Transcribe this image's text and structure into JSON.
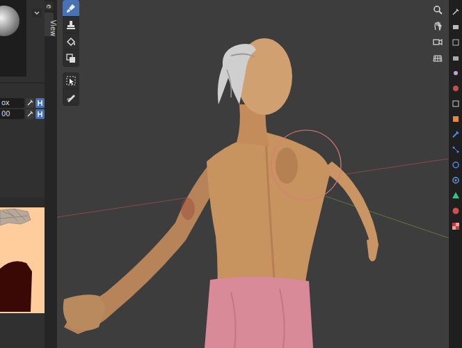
{
  "panel": {
    "rows": [
      {
        "label": "ox",
        "toggled": true
      },
      {
        "label": "00",
        "toggled": true
      }
    ]
  },
  "side_tabs": [
    {
      "label": "e",
      "selected": false
    },
    {
      "label": "View",
      "selected": true
    }
  ],
  "tools": [
    {
      "selected": true
    },
    {
      "selected": false
    },
    {
      "selected": false
    },
    {
      "selected": false
    },
    {
      "selected": false
    },
    {
      "selected": false
    }
  ]
}
